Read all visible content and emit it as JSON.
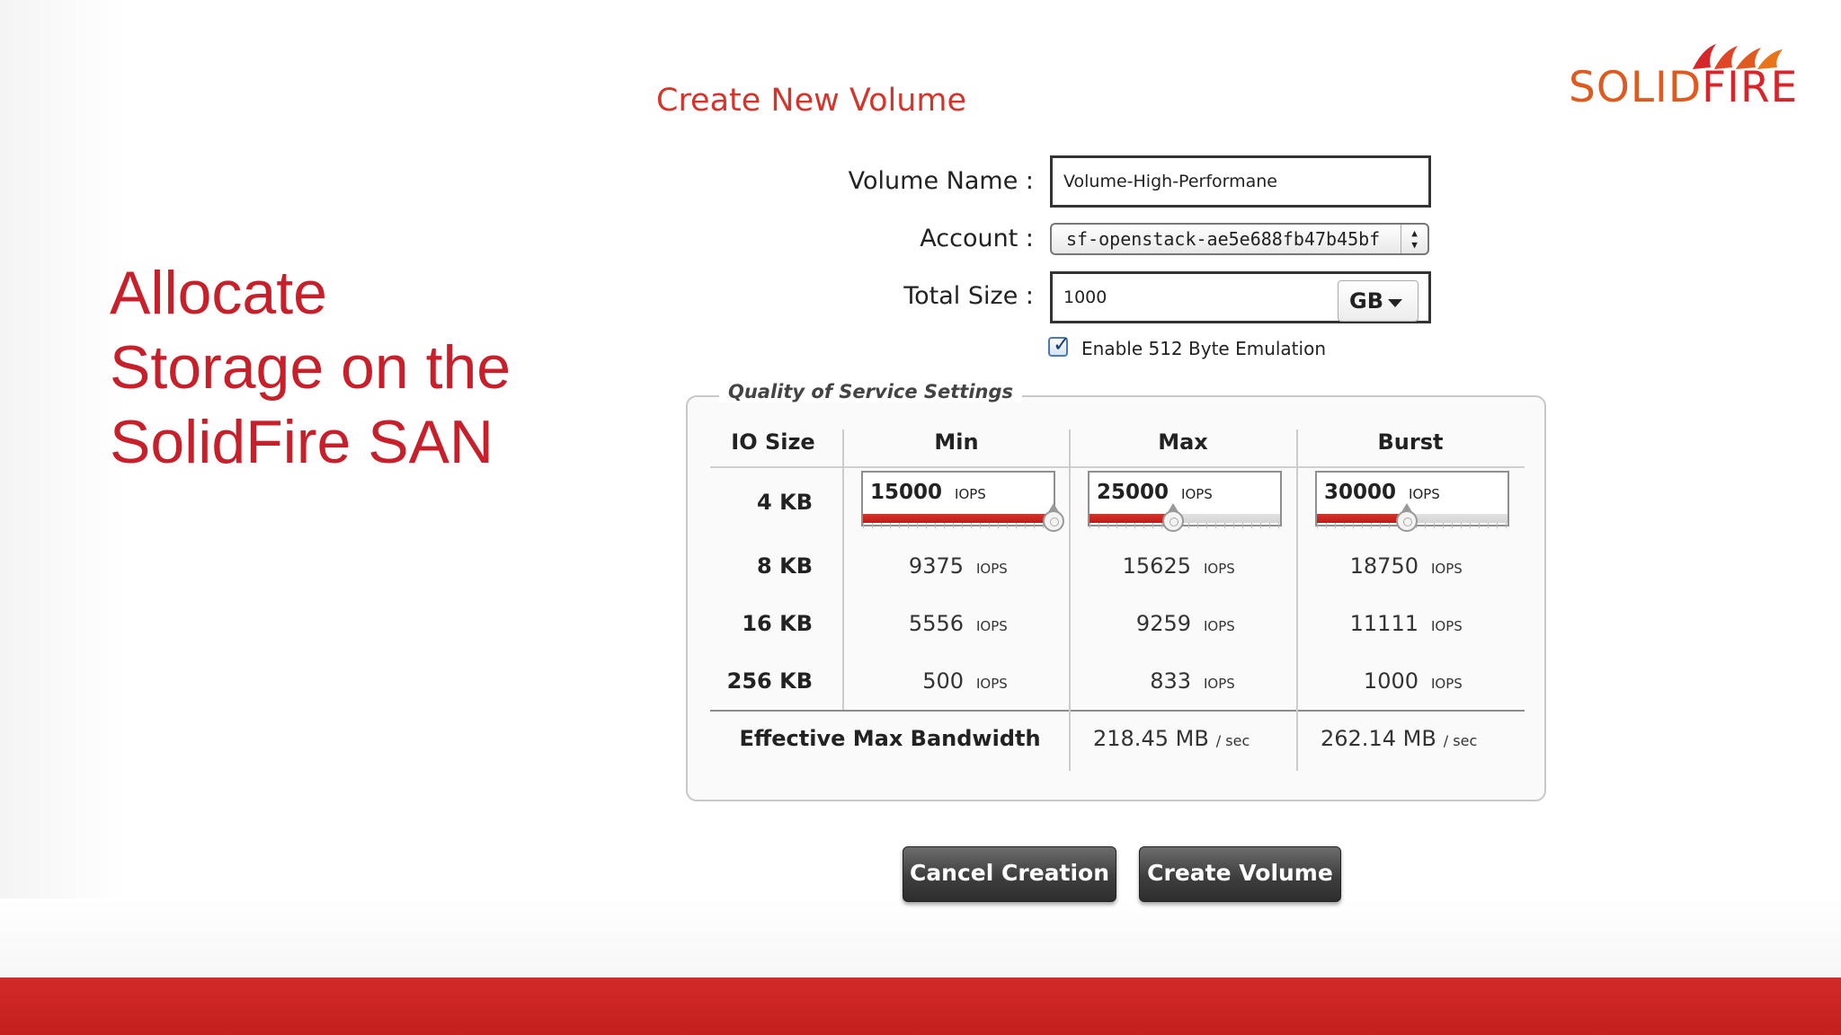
{
  "slide": {
    "title_line1": "Allocate",
    "title_line2": "Storage on the",
    "title_line3": "SolidFire SAN",
    "logo_part1": "SOLID",
    "logo_part2": "FIRE",
    "accent_red": "#c8202b",
    "footer_red": "#d32a28"
  },
  "form": {
    "title": "Create New Volume",
    "volume_name_label": "Volume Name :",
    "volume_name_value": "Volume-High-Performane",
    "account_label": "Account :",
    "account_value": "sf-openstack-ae5e688fb47b45bf",
    "total_size_label": "Total Size :",
    "total_size_value": "1000",
    "size_unit": "GB",
    "emulation_label": "Enable 512 Byte Emulation",
    "emulation_checked": true
  },
  "qos": {
    "legend": "Quality of Service Settings",
    "headers": [
      "IO Size",
      "Min",
      "Max",
      "Burst"
    ],
    "unit": "IOPS",
    "sliders": {
      "min": {
        "value": "15000",
        "fraction": 1.0
      },
      "max": {
        "value": "25000",
        "fraction": 0.44
      },
      "burst": {
        "value": "30000",
        "fraction": 0.47
      }
    },
    "rows": [
      {
        "size": "4 KB"
      },
      {
        "size": "8 KB",
        "min": "9375",
        "max": "15625",
        "burst": "18750"
      },
      {
        "size": "16 KB",
        "min": "5556",
        "max": "9259",
        "burst": "11111"
      },
      {
        "size": "256 KB",
        "min": "500",
        "max": "833",
        "burst": "1000"
      }
    ],
    "bandwidth_label": "Effective Max Bandwidth",
    "bandwidth_max": "218.45 MB",
    "bandwidth_burst": "262.14 MB",
    "bandwidth_unit": "/ sec"
  },
  "buttons": {
    "cancel": "Cancel Creation",
    "create": "Create Volume"
  }
}
